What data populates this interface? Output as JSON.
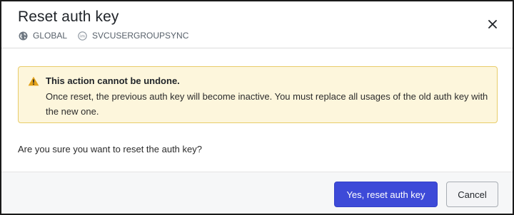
{
  "dialog": {
    "title": "Reset auth key",
    "meta": {
      "scope_icon": "globe-icon",
      "scope_label": "GLOBAL",
      "user_icon": "user-badge-icon",
      "user_label": "SVCUSERGROUPSYNC"
    },
    "close_icon": "close-icon"
  },
  "warning": {
    "icon": "warning-triangle-icon",
    "title": "This action cannot be undone.",
    "body": "Once reset, the previous auth key will become inactive. You must replace all usages of the old auth key with the new one."
  },
  "question": "Are you sure you want to reset the auth key?",
  "footer": {
    "confirm_label": "Yes, reset auth key",
    "cancel_label": "Cancel"
  },
  "colors": {
    "primary": "#3d4ad8",
    "warning_bg": "#fdf6dc",
    "warning_border": "#e8cc6a",
    "warning_icon": "#e3a21a"
  }
}
